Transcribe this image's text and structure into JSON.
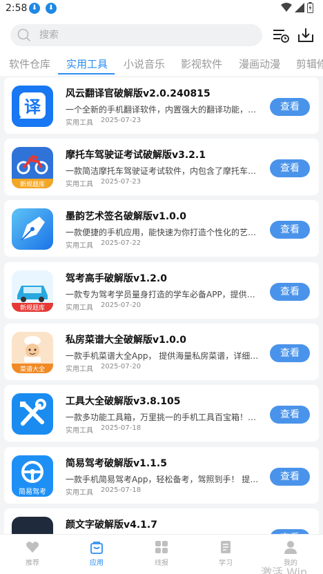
{
  "status_bar": {
    "time": "2:58",
    "download_icons": [
      "download-icon",
      "download-icon"
    ],
    "right_icons": [
      "wifi-icon",
      "signal-icon",
      "battery-icon"
    ]
  },
  "search": {
    "placeholder": "搜索"
  },
  "header_icons": [
    "history-list-icon",
    "download-tray-icon"
  ],
  "tabs": [
    {
      "label": "软件仓库",
      "active": false
    },
    {
      "label": "实用工具",
      "active": true
    },
    {
      "label": "小说音乐",
      "active": false
    },
    {
      "label": "影视软件",
      "active": false
    },
    {
      "label": "漫画动漫",
      "active": false
    },
    {
      "label": "剪辑修",
      "active": false
    }
  ],
  "accent_color": "#2b8cf0",
  "button_color": "#4a93ea",
  "apps": [
    {
      "title": "风云翻译官破解版v2.0.240815",
      "desc": "一个全新的手机翻译软件，内置强大的翻译功能，支持多国语言互译",
      "category": "实用工具",
      "date": "2025-07-23",
      "button": "查看",
      "icon": "translate-app-icon",
      "icon_text": "译"
    },
    {
      "title": "摩托车驾驶证考试破解版v3.2.1",
      "desc": "一款简洁摩托车驾驶证考试软件，内包含了摩托车驾照考试题库",
      "category": "实用工具",
      "date": "2025-07-23",
      "button": "查看",
      "icon": "motorcycle-app-icon",
      "icon_text": "新规题库"
    },
    {
      "title": "墨韵艺术签名破解版v1.0.0",
      "desc": "一款便捷的手机应用，能快速为你打造个性化的艺术签名",
      "category": "实用工具",
      "date": "2025-07-22",
      "button": "查看",
      "icon": "pen-app-icon",
      "icon_text": ""
    },
    {
      "title": "驾考高手破解版v1.2.0",
      "desc": "一款专为驾考学员量身打造的学车必备APP，提供海量题库",
      "category": "实用工具",
      "date": "2025-07-20",
      "button": "查看",
      "icon": "car-app-icon",
      "icon_text": "新规题库"
    },
    {
      "title": "私房菜谱大全破解版v1.0.0",
      "desc": "一款手机菜谱大全App， 提供海量私房菜谱，详细的做法步骤",
      "category": "实用工具",
      "date": "2025-07-20",
      "button": "查看",
      "icon": "chef-app-icon",
      "icon_text": "菜谱大全"
    },
    {
      "title": "工具大全破解版v3.8.105",
      "desc": "一款多功能工具箱，万里挑一的手机工具百宝箱！功能齐全",
      "category": "实用工具",
      "date": "2025-07-18",
      "button": "查看",
      "icon": "tools-app-icon",
      "icon_text": ""
    },
    {
      "title": "简易驾考破解版v1.1.5",
      "desc": "一款手机简易驾考App，轻松备考，驾照到手！ 提供科目一科目四",
      "category": "实用工具",
      "date": "2025-07-18",
      "button": "查看",
      "icon": "steering-wheel-app-icon",
      "icon_text": "简易驾考"
    },
    {
      "title": "颜文字破解版v4.1.7",
      "desc": "",
      "category": "",
      "date": "",
      "button": "查看",
      "icon": "emoticon-app-icon",
      "icon_text": ""
    }
  ],
  "bottom_nav": [
    {
      "label": "推荐",
      "icon": "heart-icon",
      "active": false
    },
    {
      "label": "应用",
      "icon": "bag-icon",
      "active": true
    },
    {
      "label": "线报",
      "icon": "grid-icon",
      "active": false
    },
    {
      "label": "学习",
      "icon": "book-icon",
      "active": false
    },
    {
      "label": "我的",
      "icon": "person-icon",
      "active": false
    }
  ],
  "watermark": "激活 Win"
}
